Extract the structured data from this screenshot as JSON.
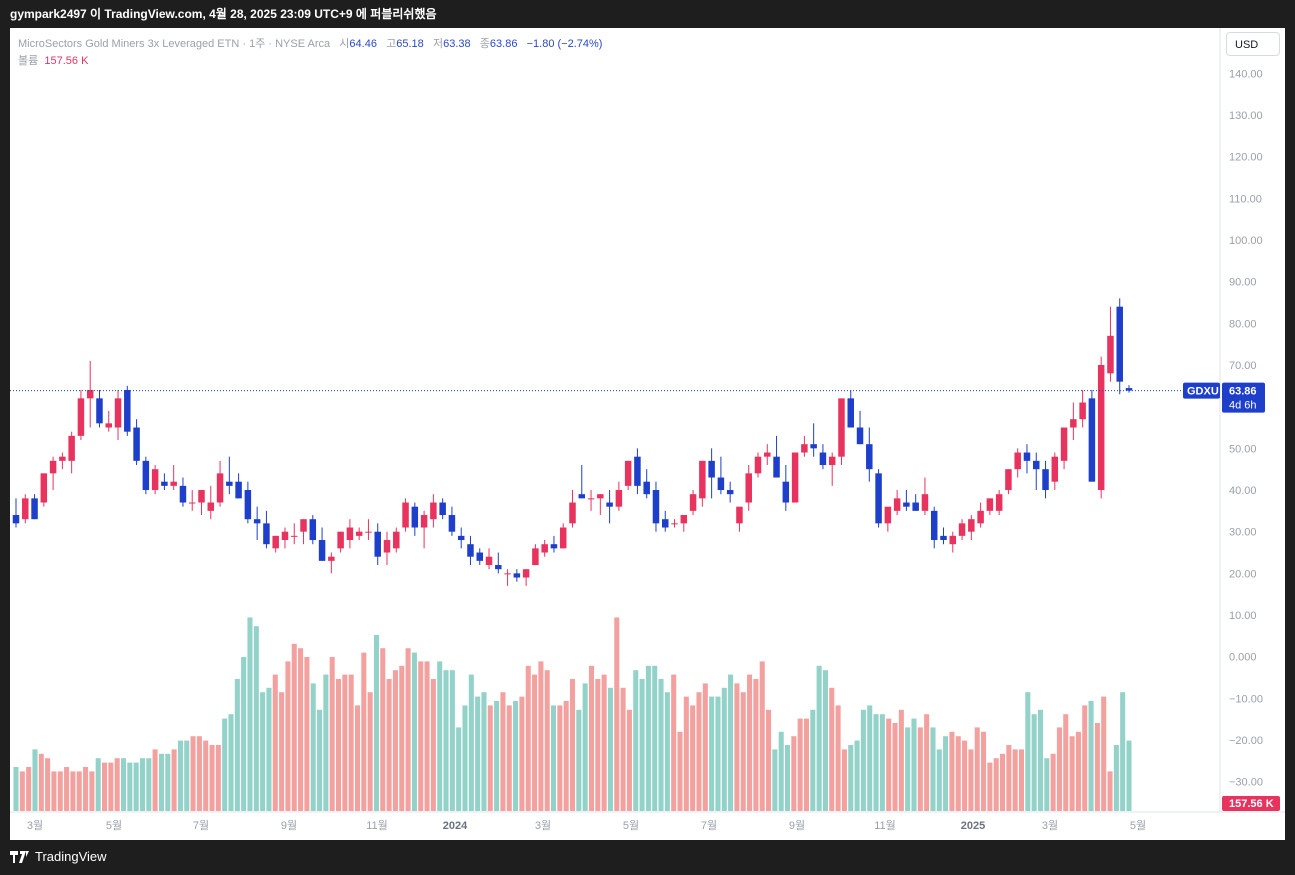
{
  "header": {
    "published_text": "gympark2497 이 TradingView.com, 4월 28, 2025 23:09 UTC+9 에 퍼블리쉬했음"
  },
  "legend": {
    "symbol_desc": "MicroSectors Gold Miners 3x Leveraged ETN · 1주 · NYSE Arca",
    "open_label": "시",
    "open_value": "64.46",
    "high_label": "고",
    "high_value": "65.18",
    "low_label": "저",
    "low_value": "63.38",
    "close_label": "종",
    "close_value": "63.86",
    "change_value": "−1.80 (−2.74%)",
    "volume_label": "볼륨",
    "volume_value": "157.56 K"
  },
  "currency_button": "USD",
  "branding": "TradingView",
  "colors": {
    "up": "#e8335e",
    "down": "#1e3fc9",
    "vol_up": "#f3a19f",
    "vol_down": "#92d2c9"
  },
  "chart_data": {
    "type": "candlestick",
    "symbol": "GDXU",
    "interval": "1주",
    "y_ticks": [
      "140.00",
      "130.00",
      "120.00",
      "110.00",
      "100.00",
      "90.00",
      "80.00",
      "70.00",
      "60.00",
      "50.00",
      "40.00",
      "30.00",
      "20.00",
      "10.00",
      "0.000",
      "−10.00",
      "−20.00",
      "−30.00"
    ],
    "y_tick_values": [
      140,
      130,
      120,
      110,
      100,
      90,
      80,
      70,
      60,
      50,
      40,
      30,
      20,
      10,
      0,
      -10,
      -20,
      -30
    ],
    "x_ticks": [
      "3월",
      "5월",
      "7월",
      "9월",
      "11월",
      "2024",
      "3월",
      "5월",
      "7월",
      "9월",
      "11월",
      "2025",
      "3월",
      "5월"
    ],
    "last_price": {
      "symbol_label": "GDXU",
      "price": "63.86",
      "countdown": "4d 6h",
      "value": 63.86
    },
    "volume_last": "157.56 K",
    "ohlc": [
      [
        34,
        38,
        31,
        32
      ],
      [
        33,
        39,
        32,
        38
      ],
      [
        38,
        39,
        33,
        33
      ],
      [
        37,
        44,
        36,
        44
      ],
      [
        44,
        48,
        40,
        47
      ],
      [
        47,
        49,
        45,
        48
      ],
      [
        47,
        54,
        44,
        53
      ],
      [
        53,
        64,
        52,
        62
      ],
      [
        62,
        71,
        55,
        64
      ],
      [
        62,
        64,
        55,
        56
      ],
      [
        55,
        59,
        54,
        56
      ],
      [
        55,
        64,
        52,
        62
      ],
      [
        64,
        65,
        53,
        54
      ],
      [
        55,
        57,
        46,
        47
      ],
      [
        47,
        48,
        39,
        40
      ],
      [
        40,
        46,
        39,
        45
      ],
      [
        42,
        44,
        40,
        41
      ],
      [
        41,
        46,
        40,
        42
      ],
      [
        41,
        43,
        36,
        37
      ],
      [
        37,
        40,
        35,
        37
      ],
      [
        37,
        40,
        34,
        40
      ],
      [
        35,
        41,
        33,
        37
      ],
      [
        37,
        47,
        36,
        44
      ],
      [
        42,
        48,
        39,
        41
      ],
      [
        42,
        44,
        38,
        38
      ],
      [
        40,
        42,
        32,
        33
      ],
      [
        33,
        36,
        28,
        32
      ],
      [
        32,
        35,
        26,
        27
      ],
      [
        26,
        29,
        25,
        29
      ],
      [
        28,
        31,
        26,
        30
      ],
      [
        29,
        32,
        27,
        29
      ],
      [
        30,
        33,
        27,
        33
      ],
      [
        33,
        34,
        27,
        28
      ],
      [
        28,
        31,
        23,
        23
      ],
      [
        23,
        25,
        20,
        24
      ],
      [
        26,
        30,
        25,
        30
      ],
      [
        28,
        33,
        26,
        31
      ],
      [
        29,
        31,
        28,
        30
      ],
      [
        30,
        33,
        28,
        30
      ],
      [
        30,
        32,
        22,
        24
      ],
      [
        25,
        30,
        22,
        28
      ],
      [
        26,
        31,
        25,
        30
      ],
      [
        31,
        38,
        30,
        37
      ],
      [
        36,
        37,
        29,
        31
      ],
      [
        31,
        35,
        26,
        34
      ],
      [
        33,
        39,
        31,
        37
      ],
      [
        37,
        38,
        33,
        34
      ],
      [
        34,
        36,
        29,
        30
      ],
      [
        29,
        31,
        26,
        28
      ],
      [
        27,
        29,
        22,
        24
      ],
      [
        25,
        26,
        22,
        23
      ],
      [
        22,
        26,
        21,
        24
      ],
      [
        22,
        25,
        20,
        21
      ],
      [
        20,
        21,
        17,
        20
      ],
      [
        20,
        21,
        18,
        19
      ],
      [
        19,
        21,
        17,
        21
      ],
      [
        22,
        27,
        22,
        26
      ],
      [
        25,
        28,
        24,
        27
      ],
      [
        27,
        29,
        25,
        26
      ],
      [
        26,
        32,
        26,
        31
      ],
      [
        32,
        40,
        31,
        37
      ],
      [
        39,
        46,
        38,
        38
      ],
      [
        38,
        40,
        35,
        38
      ],
      [
        38,
        39,
        34,
        39
      ],
      [
        37,
        40,
        32,
        36
      ],
      [
        36,
        42,
        35,
        40
      ],
      [
        41,
        47,
        40,
        47
      ],
      [
        48,
        50,
        39,
        41
      ],
      [
        42,
        45,
        38,
        39
      ],
      [
        40,
        42,
        30,
        32
      ],
      [
        33,
        35,
        30,
        31
      ],
      [
        32,
        33,
        31,
        32
      ],
      [
        32,
        33,
        30,
        34
      ],
      [
        35,
        40,
        34,
        39
      ],
      [
        38,
        47,
        36,
        47
      ],
      [
        47,
        50,
        38,
        43
      ],
      [
        43,
        48,
        39,
        40
      ],
      [
        40,
        42,
        37,
        39
      ],
      [
        32,
        35,
        30,
        36
      ],
      [
        37,
        46,
        35,
        44
      ],
      [
        44,
        49,
        43,
        48
      ],
      [
        48,
        51,
        46,
        49
      ],
      [
        48,
        53,
        43,
        43
      ],
      [
        42,
        46,
        35,
        37
      ],
      [
        37,
        49,
        37,
        49
      ],
      [
        49,
        53,
        48,
        51
      ],
      [
        51,
        56,
        48,
        50
      ],
      [
        49,
        51,
        45,
        46
      ],
      [
        46,
        49,
        41,
        48
      ],
      [
        48,
        60,
        46,
        62
      ],
      [
        62,
        64,
        55,
        55
      ],
      [
        55,
        59,
        51,
        51
      ],
      [
        51,
        55,
        42,
        45
      ],
      [
        44,
        45,
        31,
        32
      ],
      [
        32,
        35,
        30,
        36
      ],
      [
        35,
        40,
        34,
        38
      ],
      [
        37,
        40,
        35,
        36
      ],
      [
        37,
        39,
        35,
        35
      ],
      [
        35,
        43,
        34,
        39
      ],
      [
        35,
        36,
        26,
        28
      ],
      [
        29,
        31,
        27,
        28
      ],
      [
        27,
        30,
        25,
        29
      ],
      [
        29,
        33,
        28,
        32
      ],
      [
        30,
        34,
        28,
        33
      ],
      [
        32,
        37,
        31,
        35
      ],
      [
        35,
        38,
        34,
        38
      ],
      [
        35,
        40,
        34,
        39
      ],
      [
        40,
        45,
        39,
        45
      ],
      [
        45,
        50,
        43,
        49
      ],
      [
        49,
        51,
        44,
        47
      ],
      [
        47,
        49,
        40,
        45
      ],
      [
        45,
        47,
        38,
        40
      ],
      [
        42,
        49,
        40,
        48
      ],
      [
        47,
        53,
        45,
        55
      ],
      [
        55,
        61,
        52,
        57
      ],
      [
        57,
        64,
        55,
        61
      ],
      [
        62,
        64,
        44,
        42
      ],
      [
        40,
        72,
        38,
        70
      ],
      [
        68,
        84,
        66,
        77
      ],
      [
        84,
        86,
        63,
        66
      ],
      [
        64.46,
        65.18,
        63.38,
        63.86
      ]
    ],
    "volume": [
      10,
      9,
      10,
      14,
      13,
      12,
      9,
      9,
      10,
      9,
      9,
      10,
      9,
      12,
      11,
      11,
      12,
      12,
      11,
      11,
      12,
      12,
      14,
      13,
      13,
      14,
      16,
      16,
      17,
      17,
      16,
      15,
      15,
      21,
      22,
      30,
      35,
      44,
      42,
      27,
      28,
      31,
      27,
      34,
      38,
      37,
      35,
      29,
      23,
      31,
      35,
      30,
      31,
      31,
      24,
      36,
      27,
      40,
      37,
      30,
      32,
      33,
      37,
      36,
      34,
      34,
      30,
      34,
      32,
      32,
      19,
      24,
      31,
      26,
      27,
      24,
      25,
      27,
      24,
      25,
      26,
      33,
      31,
      34,
      32,
      24,
      24,
      25,
      30,
      23,
      29,
      33,
      30,
      31,
      28,
      44,
      28,
      23,
      32,
      30,
      33,
      33,
      30,
      27,
      31,
      18,
      26,
      24,
      27,
      29,
      26,
      26,
      28,
      31,
      29,
      27,
      31,
      30,
      34,
      23,
      14,
      18,
      15,
      17,
      21,
      21,
      23,
      33,
      32,
      28,
      24,
      14,
      15,
      16,
      23,
      24,
      22,
      22,
      21,
      20,
      23,
      19,
      21,
      19,
      22,
      19,
      14,
      17,
      18,
      17,
      16,
      14,
      19,
      18,
      11,
      12,
      13,
      15,
      14,
      14,
      27,
      22,
      23,
      12,
      13,
      19,
      22,
      17,
      18,
      24,
      25,
      20,
      26,
      9,
      15,
      27,
      16
    ]
  }
}
